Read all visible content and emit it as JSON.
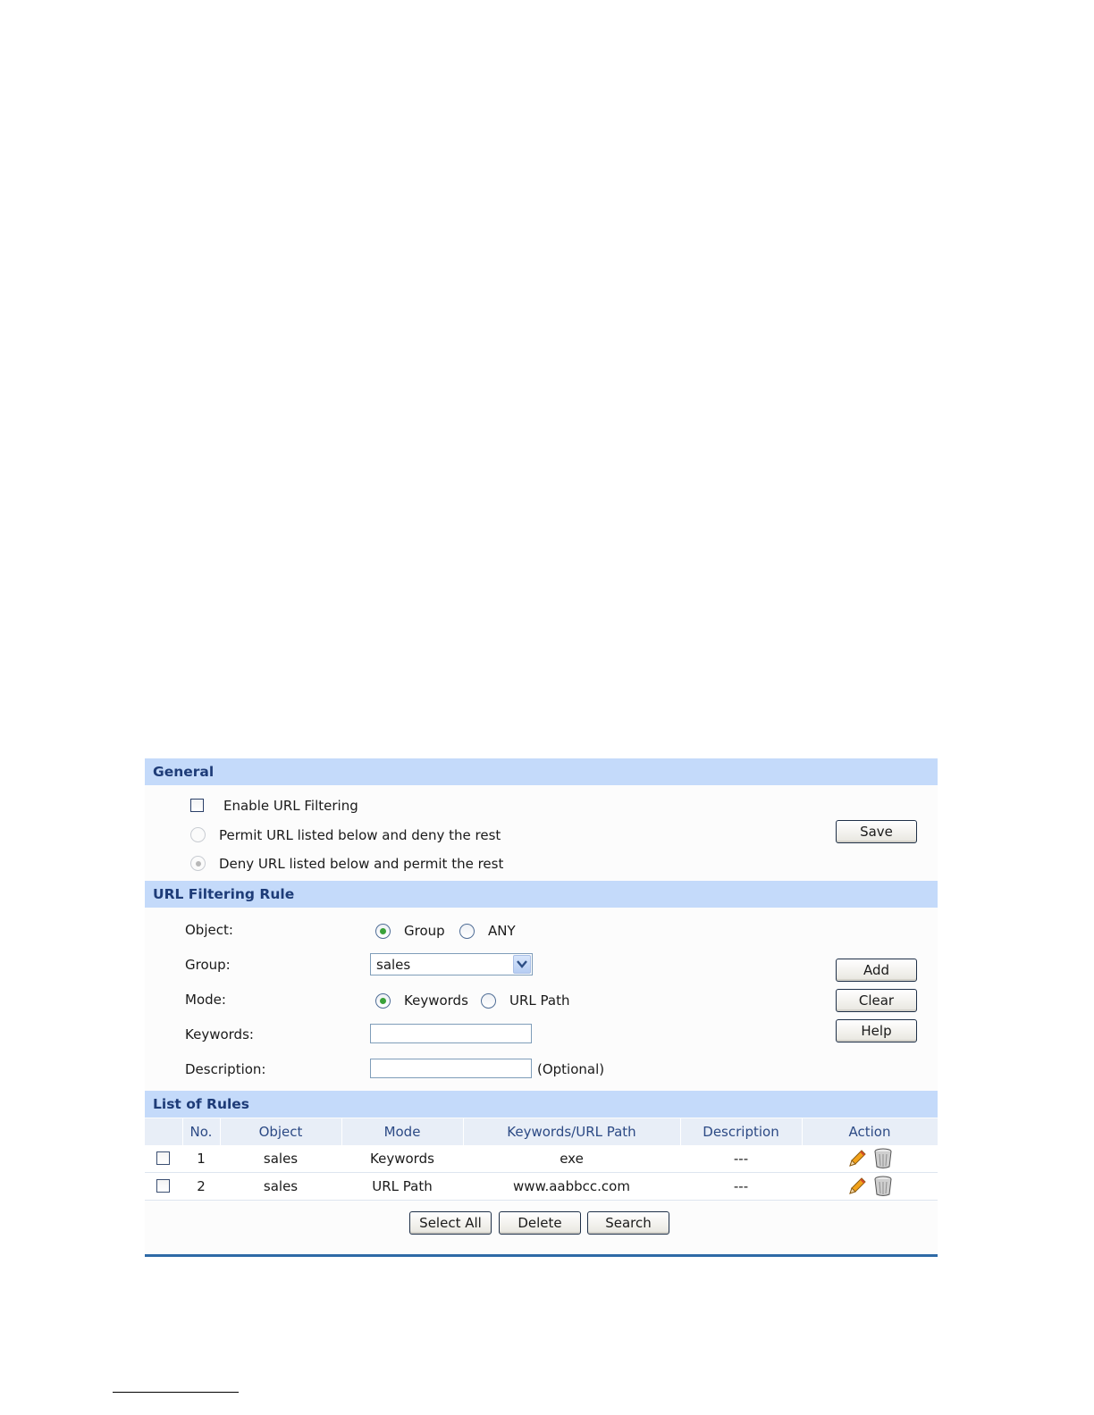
{
  "general": {
    "title": "General",
    "enable_label": "Enable URL Filtering",
    "permit_label": "Permit URL listed below and deny the rest",
    "deny_label": "Deny URL listed below and permit the rest",
    "save_label": "Save"
  },
  "rule": {
    "title": "URL Filtering Rule",
    "object_label": "Object:",
    "object_options": [
      "Group",
      "ANY"
    ],
    "group_label": "Group:",
    "group_value": "sales",
    "mode_label": "Mode:",
    "mode_options": [
      "Keywords",
      "URL Path"
    ],
    "keywords_label": "Keywords:",
    "keywords_value": "",
    "description_label": "Description:",
    "description_value": "",
    "optional_note": "(Optional)",
    "add_label": "Add",
    "clear_label": "Clear",
    "help_label": "Help"
  },
  "list": {
    "title": "List of Rules",
    "columns": [
      "No.",
      "Object",
      "Mode",
      "Keywords/URL Path",
      "Description",
      "Action"
    ],
    "rows": [
      {
        "no": "1",
        "object": "sales",
        "mode": "Keywords",
        "path": "exe",
        "description": "---"
      },
      {
        "no": "2",
        "object": "sales",
        "mode": "URL Path",
        "path": "www.aabbcc.com",
        "description": "---"
      }
    ],
    "select_all_label": "Select All",
    "delete_label": "Delete",
    "search_label": "Search"
  },
  "icons": {
    "edit": "pencil-icon",
    "delete": "trash-icon",
    "dropdown": "chevron-down-icon"
  }
}
